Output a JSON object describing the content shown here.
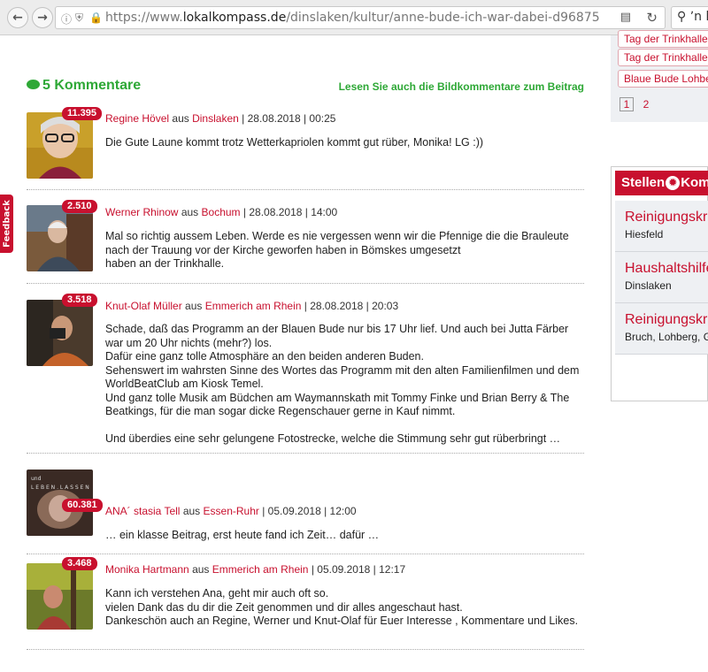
{
  "browser": {
    "url_prefix": "https://www.",
    "url_domain": "lokalkompass.de",
    "url_path": "/dinslaken/kultur/anne-bude-ich-war-dabei-d96875",
    "search_value": "ʼn be"
  },
  "feedback_label": "Feedback",
  "comments": {
    "title": "5 Kommentare",
    "bild_link": "Lesen Sie auch die Bildkommentare zum Beitrag",
    "items": [
      {
        "badge": "11.395",
        "author": "Regine Hövel",
        "aus": "aus",
        "location": "Dinslaken",
        "datetime": "| 28.08.2018 | 00:25",
        "text": "Die Gute Laune kommt trotz Wetterkapriolen kommt gut rüber, Monika! LG :))"
      },
      {
        "badge": "2.510",
        "author": "Werner Rhinow",
        "aus": "aus",
        "location": "Bochum",
        "datetime": "| 28.08.2018 | 14:00",
        "text": "Mal so richtig aussem Leben. Werde es nie vergessen wenn wir die Pfennige die die Brauleute nach der Trauung vor der Kirche geworfen haben in Bömskes umgesetzt\nhaben an der Trinkhalle."
      },
      {
        "badge": "3.518",
        "author": "Knut-Olaf Müller",
        "aus": "aus",
        "location": "Emmerich am Rhein",
        "datetime": "| 28.08.2018 | 20:03",
        "text": "Schade, daß das Programm an der Blauen Bude nur bis 17 Uhr lief. Und auch bei Jutta Färber war um 20 Uhr nichts (mehr?) los.\nDafür eine ganz tolle Atmosphäre an den beiden anderen Buden.\nSehenswert im wahrsten Sinne des Wortes das Programm mit den alten Familienfilmen und dem WorldBeatClub am Kiosk Temel.\nUnd ganz tolle Musik am Büdchen am Waymannskath mit Tommy Finke und Brian Berry & The Beatkings, für die man sogar dicke Regenschauer gerne in Kauf nimmt.\n\nUnd überdies eine sehr gelungene Fotostrecke, welche die Stimmung sehr gut rüberbringt …"
      },
      {
        "badge": "60.381",
        "author": "ANA´ stasia Tell",
        "aus": "aus",
        "location": "Essen-Ruhr",
        "datetime": "| 05.09.2018 | 12:00",
        "text": "… ein klasse Beitrag, erst heute fand ich Zeit… dafür …"
      },
      {
        "badge": "3.468",
        "author": "Monika Hartmann",
        "aus": "aus",
        "location": "Emmerich am Rhein",
        "datetime": "| 05.09.2018 | 12:17",
        "text": "Kann ich verstehen Ana, geht mir auch oft so.\nvielen Dank das du dir die Zeit genommen und dir alles angeschaut hast.\nDankeschön auch an Regine, Werner und Knut-Olaf für Euer Interesse , Kommentare und Likes."
      }
    ]
  },
  "sidebar": {
    "tags": [
      "Tag der Trinkhalle",
      "Tag der Trinkhalle",
      "Blaue Bude Lohberg"
    ],
    "pages": [
      "1",
      "2"
    ],
    "jobs_logo_left": "Stellen",
    "jobs_logo_right": "Kompass",
    "jobs": [
      {
        "title": "Reinigungskraft",
        "location": "Hiesfeld"
      },
      {
        "title": "Haushaltshilfe",
        "location": "Dinslaken"
      },
      {
        "title": "Reinigungskraft",
        "location": "Bruch, Lohberg, Graf"
      }
    ]
  }
}
